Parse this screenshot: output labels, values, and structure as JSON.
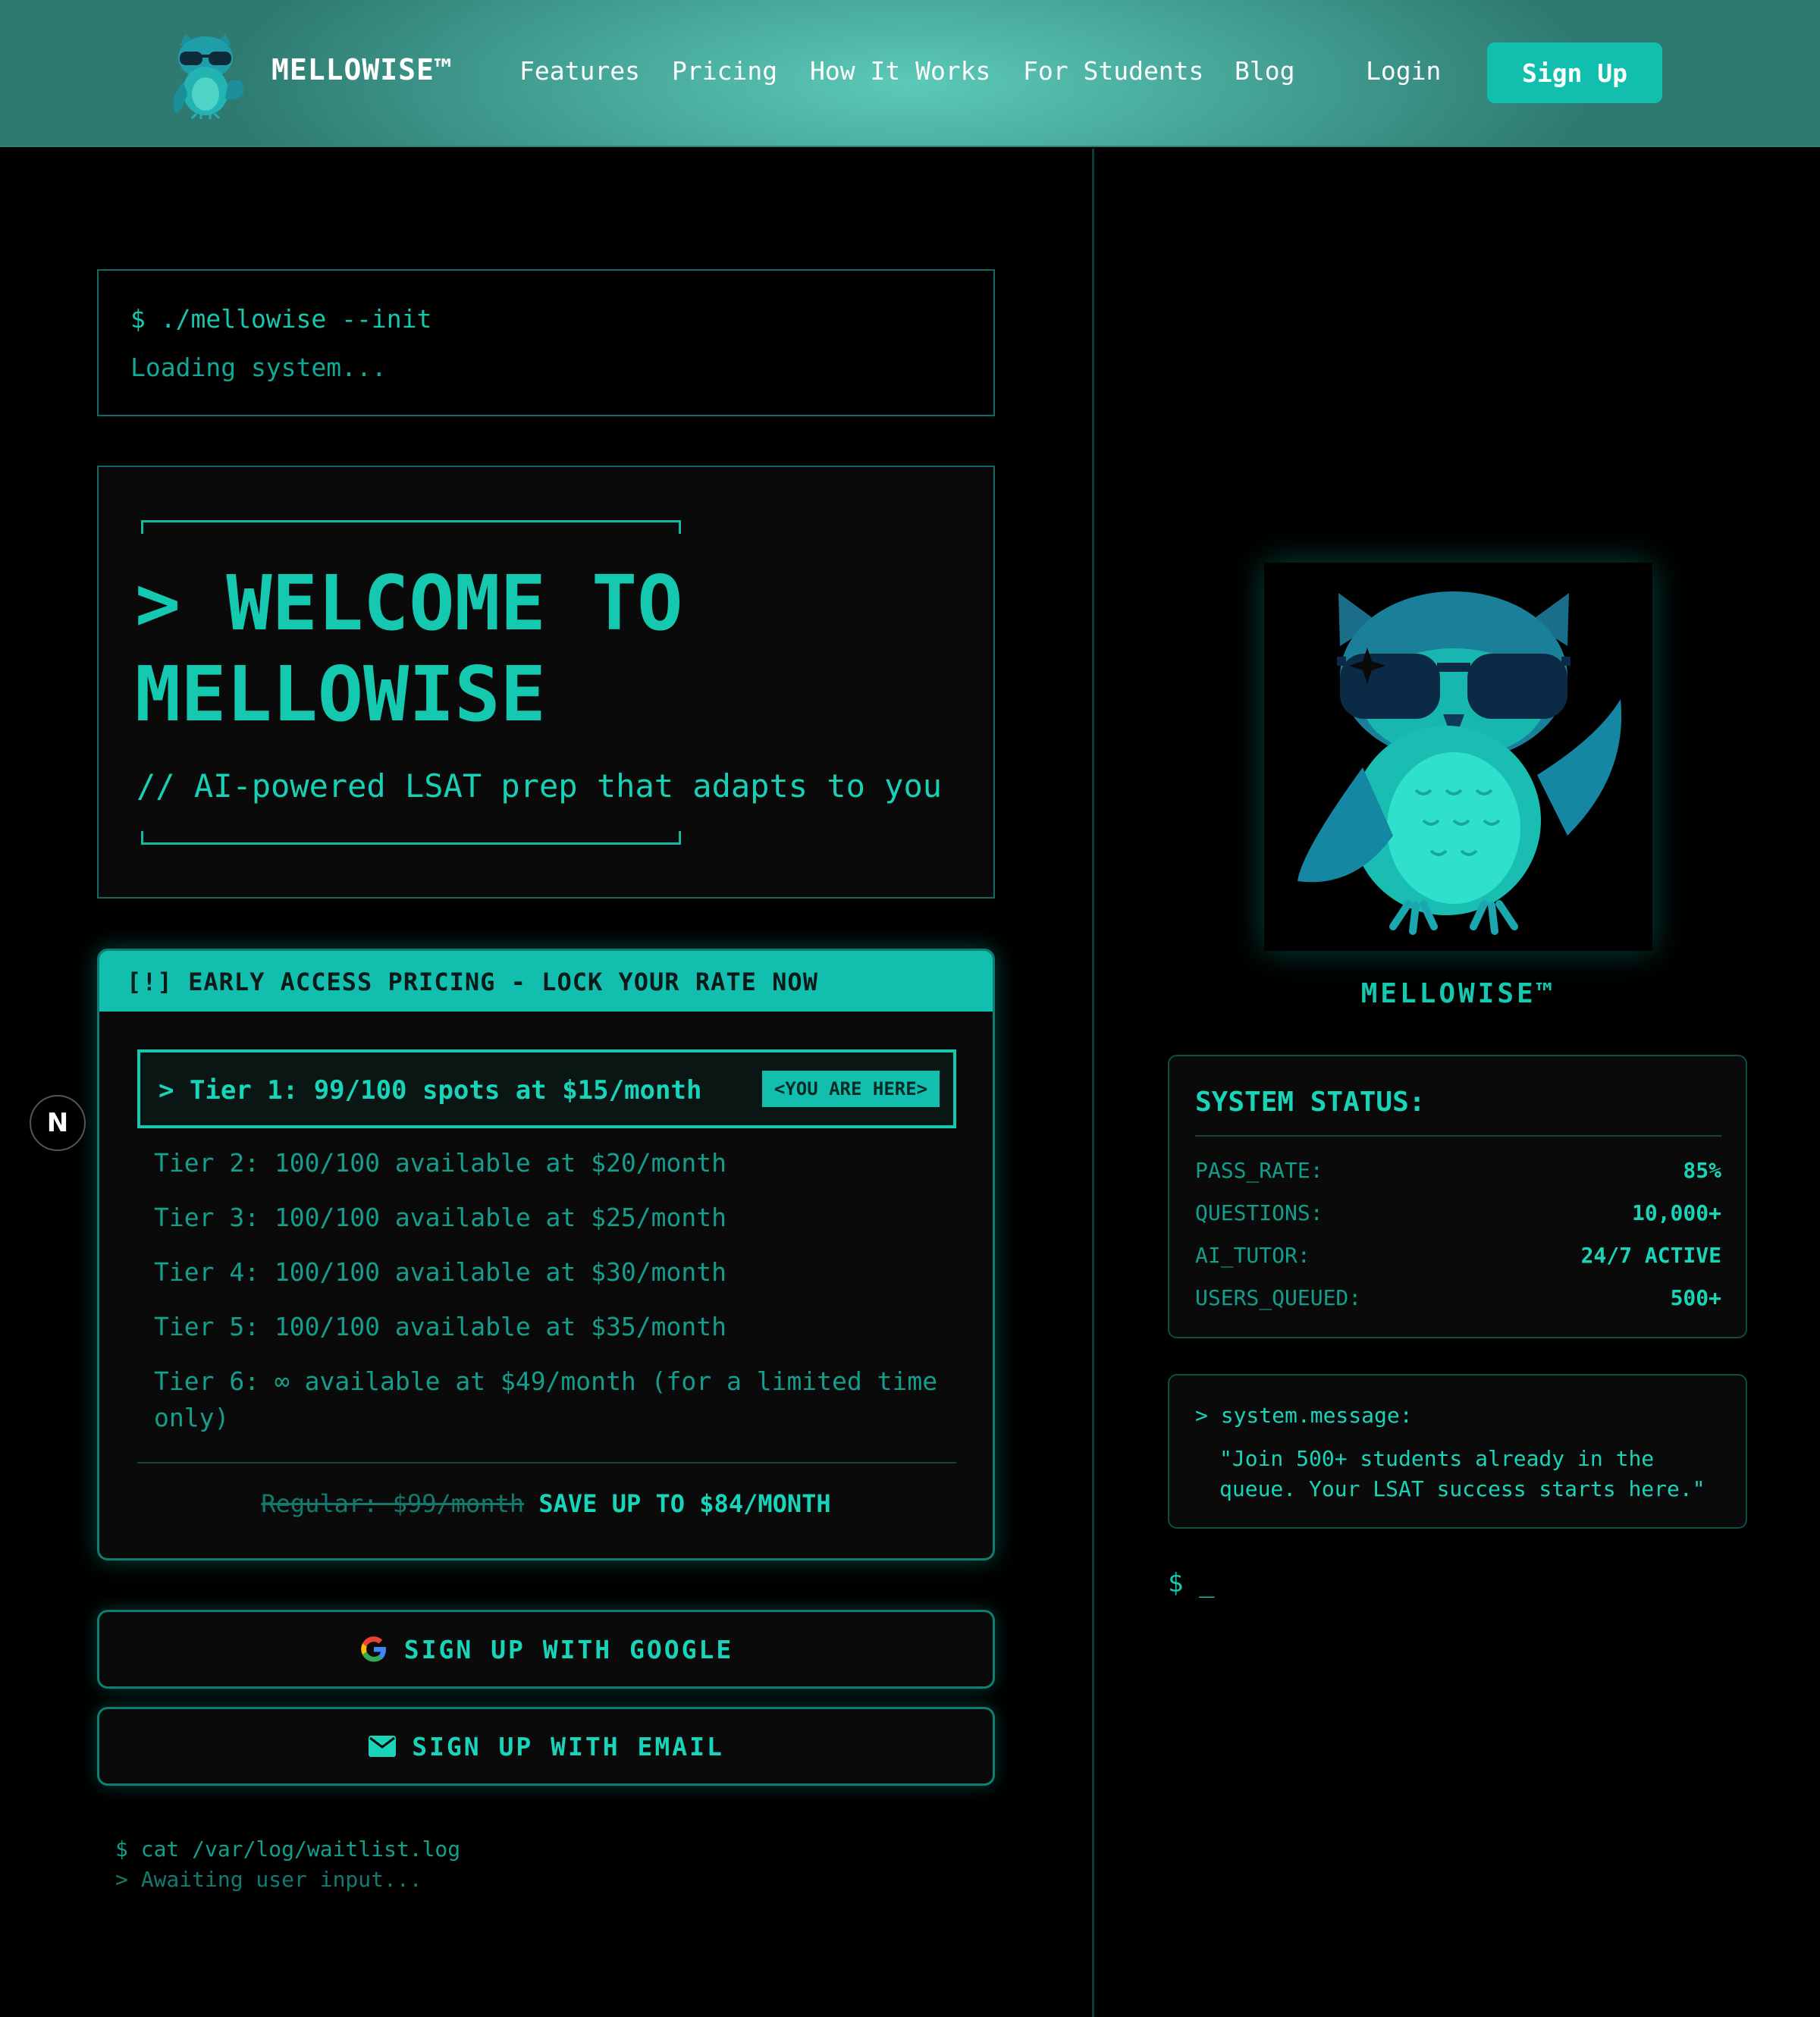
{
  "header": {
    "brand": "MELLOWISE™",
    "nav": [
      {
        "label": "Features"
      },
      {
        "label": "Pricing"
      },
      {
        "label": "How It Works"
      },
      {
        "label": "For Students"
      },
      {
        "label": "Blog"
      },
      {
        "label": "Login"
      }
    ],
    "signup_label": "Sign Up"
  },
  "terminal": {
    "command": "$ ./mellowise --init",
    "loading": "Loading system..."
  },
  "welcome": {
    "title_line1": "> WELCOME TO",
    "title_line2": "MELLOWISE",
    "subtitle": "// AI-powered LSAT prep that adapts to you"
  },
  "pricing": {
    "banner": "[!] EARLY ACCESS PRICING - LOCK YOUR RATE NOW",
    "active_tier": "> Tier 1: 99/100 spots at $15/month",
    "active_badge": "<YOU ARE HERE>",
    "tiers": [
      "Tier 2: 100/100 available at $20/month",
      "Tier 3: 100/100 available at $25/month",
      "Tier 4: 100/100 available at $30/month",
      "Tier 5: 100/100 available at $35/month",
      "Tier 6: ∞ available at $49/month (for a limited time only)"
    ],
    "regular": "Regular: $99/month",
    "save": "SAVE UP TO $84/MONTH"
  },
  "signup": {
    "google_label": "SIGN UP WITH GOOGLE",
    "email_label": "SIGN UP WITH EMAIL"
  },
  "log": {
    "command": "$ cat /var/log/waitlist.log",
    "status": "> Awaiting user input..."
  },
  "hero": {
    "caption": "MELLOWISE™"
  },
  "system_status": {
    "title": "SYSTEM STATUS:",
    "rows": [
      {
        "key": "PASS_RATE:",
        "value": "85%"
      },
      {
        "key": "QUESTIONS:",
        "value": "10,000+"
      },
      {
        "key": "AI_TUTOR:",
        "value": "24/7 ACTIVE"
      },
      {
        "key": "USERS_QUEUED:",
        "value": "500+"
      }
    ]
  },
  "system_message": {
    "head": "> system.message:",
    "body": "\"Join 500+ students already in the queue. Your LSAT success starts here.\""
  },
  "prompt": "$ _",
  "dev_badge": "N",
  "colors": {
    "accent": "#14c9b0",
    "accent_dim": "#139e8d",
    "banner": "#12bfae",
    "background": "#000000"
  }
}
